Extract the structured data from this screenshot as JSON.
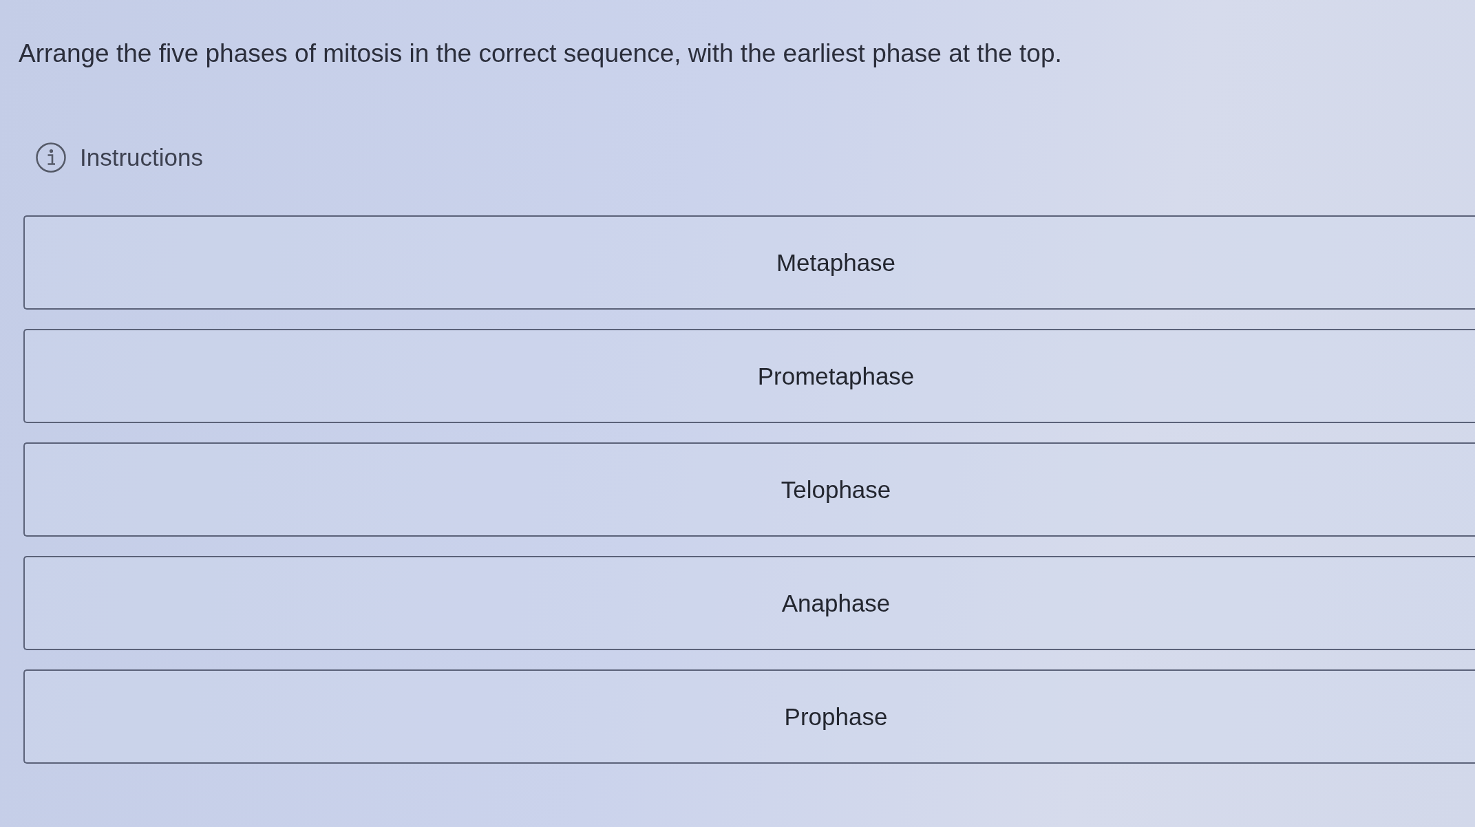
{
  "question": "Arrange the five phases of mitosis in the correct sequence, with the earliest phase at the top.",
  "instructions": {
    "label": "Instructions"
  },
  "items": [
    {
      "label": "Metaphase"
    },
    {
      "label": "Prometaphase"
    },
    {
      "label": "Telophase"
    },
    {
      "label": "Anaphase"
    },
    {
      "label": "Prophase"
    }
  ]
}
